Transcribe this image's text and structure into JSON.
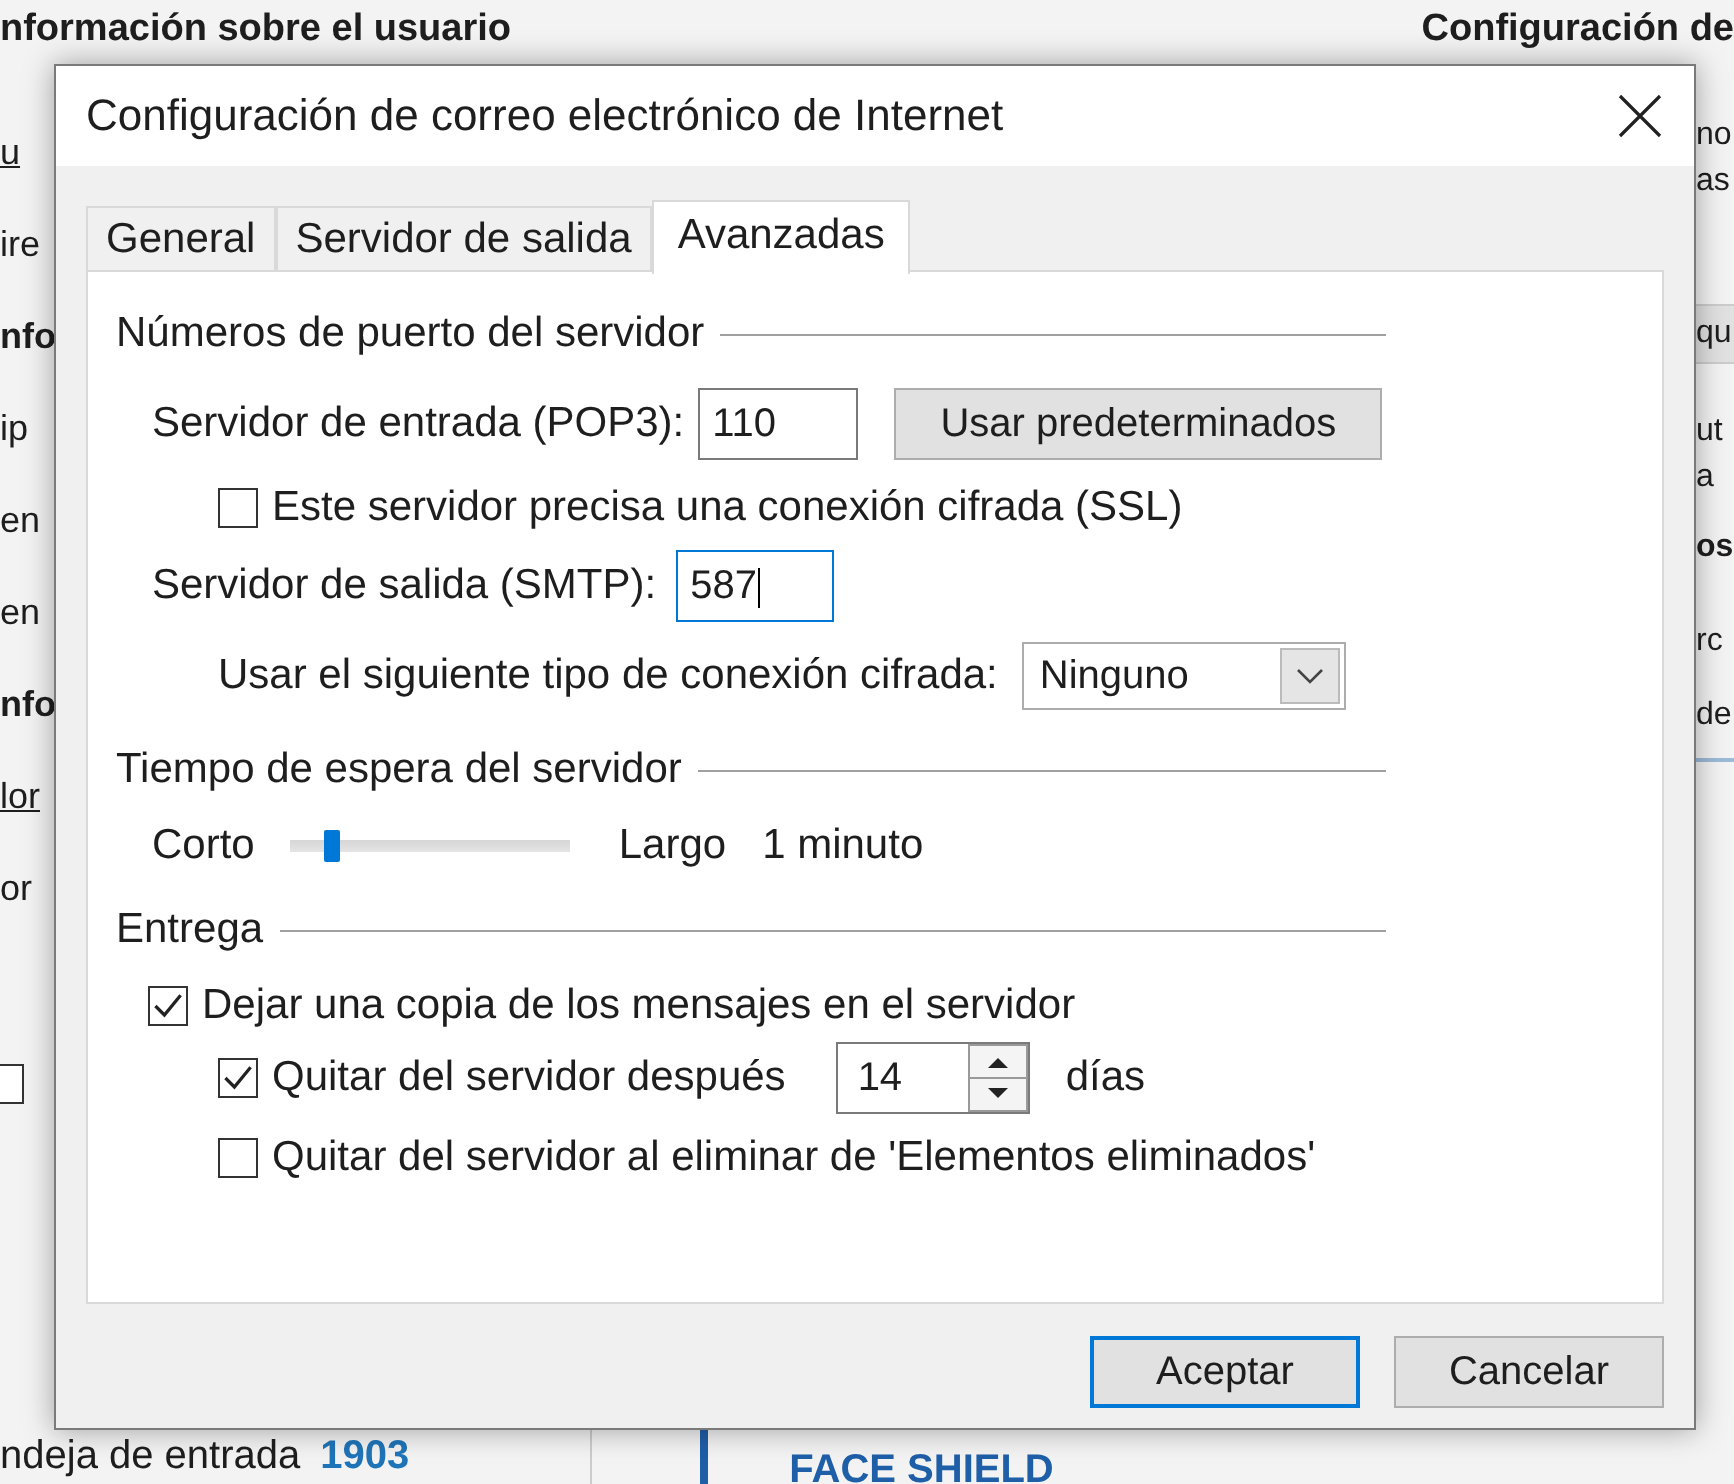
{
  "background": {
    "header_left": "nformación sobre el usuario",
    "header_right": "Configuración de",
    "left_fragments": [
      {
        "kind": "link",
        "text": "u"
      },
      {
        "kind": "plain",
        "text": "ire"
      },
      {
        "kind": "heading",
        "text": "nfo"
      },
      {
        "kind": "plain",
        "text": "ip"
      },
      {
        "kind": "plain",
        "text": "en"
      },
      {
        "kind": "plain",
        "text": "en"
      },
      {
        "kind": "heading",
        "text": "nfo"
      },
      {
        "kind": "link",
        "text": "lor"
      },
      {
        "kind": "plain",
        "text": "or"
      },
      {
        "kind": "checkbox",
        "checked": false
      }
    ],
    "right_fragments": [
      {
        "kind": "plain",
        "text": "no"
      },
      {
        "kind": "plain",
        "text": "as"
      },
      {
        "kind": "bar",
        "text": "qu"
      },
      {
        "kind": "plain",
        "text": "ut"
      },
      {
        "kind": "plain",
        "text": "a"
      },
      {
        "kind": "heading",
        "text": "os"
      },
      {
        "kind": "plain",
        "text": "rc"
      },
      {
        "kind": "plain",
        "text": "de"
      }
    ],
    "folder": "ndeja de entrada",
    "count": "1903",
    "message_title": "FACE SHIELD"
  },
  "dialog": {
    "title": "Configuración de correo electrónico de Internet",
    "tabs": [
      {
        "label": "General",
        "selected": false
      },
      {
        "label": "Servidor de salida",
        "selected": false
      },
      {
        "label": "Avanzadas",
        "selected": true
      }
    ],
    "ports": {
      "title": "Números de puerto del servidor",
      "incoming": {
        "label": "Servidor de entrada (POP3):",
        "value": "110",
        "focused": false
      },
      "defaults_button": "Usar predeterminados",
      "ssl": {
        "label": "Este servidor precisa una conexión cifrada (SSL)",
        "checked": false
      },
      "outgoing": {
        "label": "Servidor de salida (SMTP):",
        "value": "587",
        "focused": true
      },
      "encryption": {
        "label": "Usar el siguiente tipo de conexión cifrada:",
        "value": "Ninguno"
      }
    },
    "timeout": {
      "title": "Tiempo de espera del servidor",
      "min_label": "Corto",
      "max_label": "Largo",
      "level": 0.12,
      "reading": "1 minuto"
    },
    "delivery": {
      "title": "Entrega",
      "leave_copy": {
        "label": "Dejar una copia de los mensajes en el servidor",
        "checked": true
      },
      "remove_after": {
        "label": "Quitar del servidor después",
        "checked": true,
        "value": "14",
        "unit": "días"
      },
      "remove_deleted": {
        "label": "Quitar del servidor al eliminar de 'Elementos eliminados'",
        "checked": false
      }
    },
    "buttons": [
      {
        "label": "Aceptar",
        "default": true
      },
      {
        "label": "Cancelar",
        "default": false
      }
    ]
  }
}
